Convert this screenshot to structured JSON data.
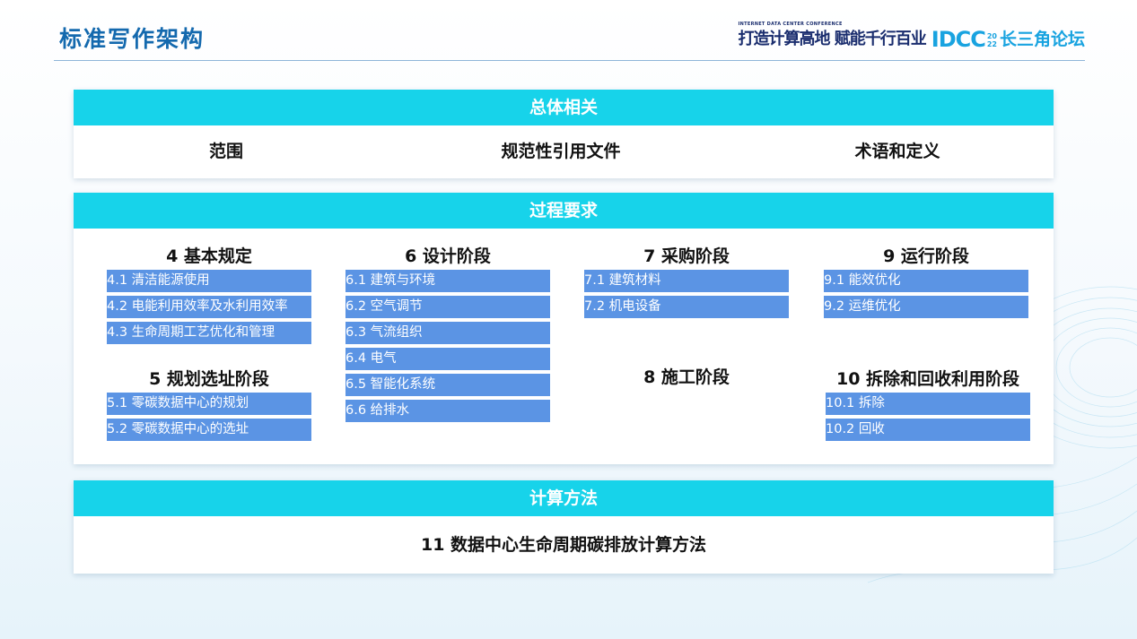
{
  "header": {
    "title": "标准写作架构",
    "logo": {
      "small_text": "INTERNET DATA CENTER CONFERENCE",
      "slogan": "打造计算高地 赋能千行百业",
      "brand": "IDCC",
      "year_top": "20",
      "year_bottom": "22",
      "forum": "长三角论坛"
    }
  },
  "general": {
    "heading": "总体相关",
    "items": [
      "范围",
      "规范性引用文件",
      "术语和定义"
    ]
  },
  "process": {
    "heading": "过程要求",
    "sections": {
      "s4": {
        "title": "4  基本规定",
        "items": [
          "4.1  清洁能源使用",
          "4.2  电能利用效率及水利用效率",
          "4.3  生命周期工艺优化和管理"
        ]
      },
      "s5": {
        "title": "5  规划选址阶段",
        "items": [
          "5.1  零碳数据中心的规划",
          "5.2  零碳数据中心的选址"
        ]
      },
      "s6": {
        "title": "6  设计阶段",
        "items": [
          "6.1  建筑与环境",
          "6.2  空气调节",
          "6.3  气流组织",
          "6.4  电气",
          "6.5  智能化系统",
          "6.6  给排水"
        ]
      },
      "s7": {
        "title": "7  采购阶段",
        "items": [
          "7.1  建筑材料",
          "7.2  机电设备"
        ]
      },
      "s8": {
        "title": "8  施工阶段",
        "items": []
      },
      "s9": {
        "title": "9  运行阶段",
        "items": [
          "9.1  能效优化",
          "9.2  运维优化"
        ]
      },
      "s10": {
        "title": "10 拆除和回收利用阶段",
        "items": [
          "10.1  拆除",
          "10.2  回收"
        ]
      }
    }
  },
  "calculation": {
    "heading": "计算方法",
    "item": "11  数据中心生命周期碳排放计算方法"
  },
  "colors": {
    "title_blue": "#1469ae",
    "section_header": "#17d3ea",
    "item_blue": "#5b94e4"
  }
}
